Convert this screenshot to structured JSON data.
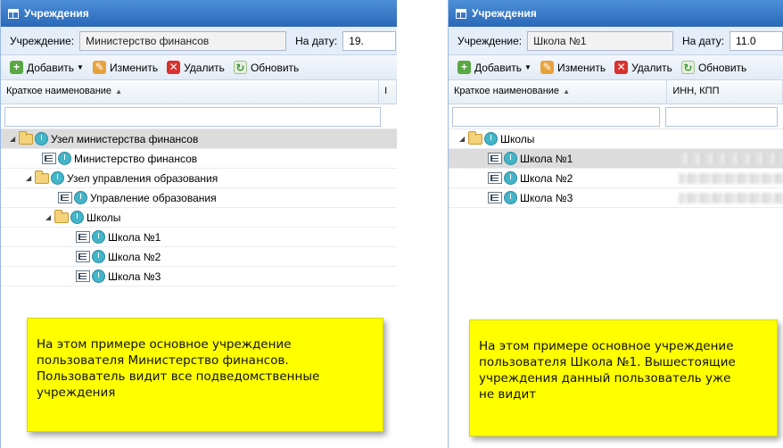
{
  "left": {
    "window_title": "Учреждения",
    "institution_label": "Учреждение:",
    "institution_value": "Министерство финансов",
    "date_label": "На дату:",
    "date_value": "19.",
    "toolbar": {
      "add_label": "Добавить",
      "edit_label": "Изменить",
      "delete_label": "Удалить",
      "refresh_label": "Обновить"
    },
    "columns": [
      "Краткое наименование",
      "I"
    ],
    "tree": [
      {
        "label": "Узел министерства финансов"
      },
      {
        "label": "Министерство финансов"
      },
      {
        "label": "Узел управления образования"
      },
      {
        "label": "Управление образования"
      },
      {
        "label": "Школы"
      },
      {
        "label": "Школа №1"
      },
      {
        "label": "Школа №2"
      },
      {
        "label": "Школа №3"
      }
    ],
    "note": "На этом примере основное учреждение\nпользователя Министерство финансов.\nПользователь видит все подведомственные\nучреждения"
  },
  "right": {
    "window_title": "Учреждения",
    "institution_label": "Учреждение:",
    "institution_value": "Школа №1",
    "date_label": "На дату:",
    "date_value": "11.0",
    "toolbar": {
      "add_label": "Добавить",
      "edit_label": "Изменить",
      "delete_label": "Удалить",
      "refresh_label": "Обновить"
    },
    "columns": [
      "Краткое наименование",
      "ИНН, КПП"
    ],
    "tree": [
      {
        "label": "Школы"
      },
      {
        "label": "Школа №1"
      },
      {
        "label": "Школа №2"
      },
      {
        "label": "Школа №3"
      }
    ],
    "note": "На этом примере основное учреждение\nпользователя Школа №1. Вышестоящие\nучреждения данный пользователь уже\nне видит"
  },
  "colors": {
    "titlebar": "#2a68b8",
    "note_bg": "#ffff00",
    "selected_row": "#dcdcdc"
  }
}
